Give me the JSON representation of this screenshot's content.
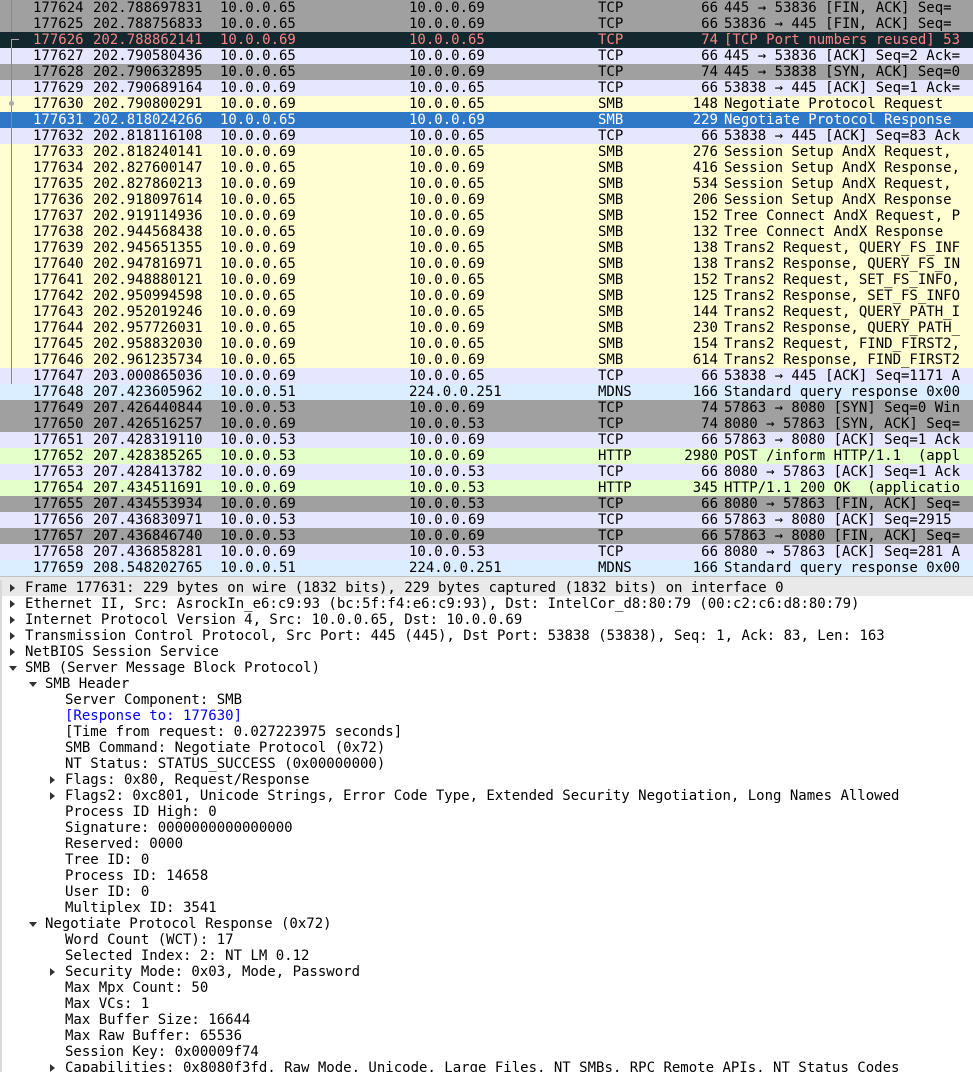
{
  "colors": {
    "tcp_light": "#e7e6ff",
    "tcp_gray": "#a0a0a0",
    "tcp_dark": "#12272e",
    "tcp_dark_text": "#f78787",
    "smb": "#fefed0",
    "selected": "#2f78c8",
    "mdns": "#daeeff",
    "http": "#e4ffc7",
    "details_highlight": "#e9e9e9",
    "link": "#0000ee"
  },
  "packets": [
    {
      "no": "177624",
      "time": "202.788697831",
      "src": "10.0.0.65",
      "dst": "10.0.0.69",
      "proto": "TCP",
      "len": "66",
      "info": "445 → 53836 [FIN, ACK] Seq=",
      "style": "tcp_gray",
      "marker": "line"
    },
    {
      "no": "177625",
      "time": "202.788756833",
      "src": "10.0.0.65",
      "dst": "10.0.0.69",
      "proto": "TCP",
      "len": "66",
      "info": "53836 → 445 [FIN, ACK] Seq=",
      "style": "tcp_gray",
      "marker": "line"
    },
    {
      "no": "177626",
      "time": "202.788862141",
      "src": "10.0.0.69",
      "dst": "10.0.0.65",
      "proto": "TCP",
      "len": "74",
      "info": "[TCP Port numbers reused] 53",
      "style": "tcp_dark",
      "marker": "corner"
    },
    {
      "no": "177627",
      "time": "202.790580436",
      "src": "10.0.0.65",
      "dst": "10.0.0.69",
      "proto": "TCP",
      "len": "66",
      "info": "445 → 53836 [ACK] Seq=2 Ack=",
      "style": "tcp_light",
      "marker": "line"
    },
    {
      "no": "177628",
      "time": "202.790632895",
      "src": "10.0.0.65",
      "dst": "10.0.0.69",
      "proto": "TCP",
      "len": "74",
      "info": "445 → 53838 [SYN, ACK] Seq=0",
      "style": "tcp_gray",
      "marker": "line"
    },
    {
      "no": "177629",
      "time": "202.790689164",
      "src": "10.0.0.69",
      "dst": "10.0.0.65",
      "proto": "TCP",
      "len": "66",
      "info": "53838 → 445 [ACK] Seq=1 Ack=",
      "style": "tcp_light",
      "marker": "line"
    },
    {
      "no": "177630",
      "time": "202.790800291",
      "src": "10.0.0.69",
      "dst": "10.0.0.65",
      "proto": "SMB",
      "len": "148",
      "info": "Negotiate Protocol Request",
      "style": "smb",
      "marker": "dot"
    },
    {
      "no": "177631",
      "time": "202.818024266",
      "src": "10.0.0.65",
      "dst": "10.0.0.69",
      "proto": "SMB",
      "len": "229",
      "info": "Negotiate Protocol Response",
      "style": "selected",
      "marker": "line"
    },
    {
      "no": "177632",
      "time": "202.818116108",
      "src": "10.0.0.69",
      "dst": "10.0.0.65",
      "proto": "TCP",
      "len": "66",
      "info": "53838 → 445 [ACK] Seq=83 Ack",
      "style": "tcp_light",
      "marker": "line"
    },
    {
      "no": "177633",
      "time": "202.818240141",
      "src": "10.0.0.69",
      "dst": "10.0.0.65",
      "proto": "SMB",
      "len": "276",
      "info": "Session Setup AndX Request, ",
      "style": "smb",
      "marker": "line"
    },
    {
      "no": "177634",
      "time": "202.827600147",
      "src": "10.0.0.65",
      "dst": "10.0.0.69",
      "proto": "SMB",
      "len": "416",
      "info": "Session Setup AndX Response,",
      "style": "smb",
      "marker": "line"
    },
    {
      "no": "177635",
      "time": "202.827860213",
      "src": "10.0.0.69",
      "dst": "10.0.0.65",
      "proto": "SMB",
      "len": "534",
      "info": "Session Setup AndX Request, ",
      "style": "smb",
      "marker": "line"
    },
    {
      "no": "177636",
      "time": "202.918097614",
      "src": "10.0.0.65",
      "dst": "10.0.0.69",
      "proto": "SMB",
      "len": "206",
      "info": "Session Setup AndX Response",
      "style": "smb",
      "marker": "line"
    },
    {
      "no": "177637",
      "time": "202.919114936",
      "src": "10.0.0.69",
      "dst": "10.0.0.65",
      "proto": "SMB",
      "len": "152",
      "info": "Tree Connect AndX Request, P",
      "style": "smb",
      "marker": "line"
    },
    {
      "no": "177638",
      "time": "202.944568438",
      "src": "10.0.0.65",
      "dst": "10.0.0.69",
      "proto": "SMB",
      "len": "132",
      "info": "Tree Connect AndX Response",
      "style": "smb",
      "marker": "line"
    },
    {
      "no": "177639",
      "time": "202.945651355",
      "src": "10.0.0.69",
      "dst": "10.0.0.65",
      "proto": "SMB",
      "len": "138",
      "info": "Trans2 Request, QUERY_FS_INF",
      "style": "smb",
      "marker": "line"
    },
    {
      "no": "177640",
      "time": "202.947816971",
      "src": "10.0.0.65",
      "dst": "10.0.0.69",
      "proto": "SMB",
      "len": "138",
      "info": "Trans2 Response, QUERY_FS_IN",
      "style": "smb",
      "marker": "line"
    },
    {
      "no": "177641",
      "time": "202.948880121",
      "src": "10.0.0.69",
      "dst": "10.0.0.65",
      "proto": "SMB",
      "len": "152",
      "info": "Trans2 Request, SET_FS_INFO,",
      "style": "smb",
      "marker": "line"
    },
    {
      "no": "177642",
      "time": "202.950994598",
      "src": "10.0.0.65",
      "dst": "10.0.0.69",
      "proto": "SMB",
      "len": "125",
      "info": "Trans2 Response, SET_FS_INFO",
      "style": "smb",
      "marker": "line"
    },
    {
      "no": "177643",
      "time": "202.952019246",
      "src": "10.0.0.69",
      "dst": "10.0.0.65",
      "proto": "SMB",
      "len": "144",
      "info": "Trans2 Request, QUERY_PATH_I",
      "style": "smb",
      "marker": "line"
    },
    {
      "no": "177644",
      "time": "202.957726031",
      "src": "10.0.0.65",
      "dst": "10.0.0.69",
      "proto": "SMB",
      "len": "230",
      "info": "Trans2 Response, QUERY_PATH_",
      "style": "smb",
      "marker": "line"
    },
    {
      "no": "177645",
      "time": "202.958832030",
      "src": "10.0.0.69",
      "dst": "10.0.0.65",
      "proto": "SMB",
      "len": "154",
      "info": "Trans2 Request, FIND_FIRST2,",
      "style": "smb",
      "marker": "line"
    },
    {
      "no": "177646",
      "time": "202.961235734",
      "src": "10.0.0.65",
      "dst": "10.0.0.69",
      "proto": "SMB",
      "len": "614",
      "info": "Trans2 Response, FIND_FIRST2",
      "style": "smb",
      "marker": "line"
    },
    {
      "no": "177647",
      "time": "203.000865036",
      "src": "10.0.0.69",
      "dst": "10.0.0.65",
      "proto": "TCP",
      "len": "66",
      "info": "53838 → 445 [ACK] Seq=1171 A",
      "style": "tcp_light",
      "marker": "line"
    },
    {
      "no": "177648",
      "time": "207.423605962",
      "src": "10.0.0.51",
      "dst": "224.0.0.251",
      "proto": "MDNS",
      "len": "166",
      "info": "Standard query response 0x00",
      "style": "mdns",
      "marker": "none"
    },
    {
      "no": "177649",
      "time": "207.426440844",
      "src": "10.0.0.53",
      "dst": "10.0.0.69",
      "proto": "TCP",
      "len": "74",
      "info": "57863 → 8080 [SYN] Seq=0 Win",
      "style": "tcp_gray",
      "marker": "none"
    },
    {
      "no": "177650",
      "time": "207.426516257",
      "src": "10.0.0.69",
      "dst": "10.0.0.53",
      "proto": "TCP",
      "len": "74",
      "info": "8080 → 57863 [SYN, ACK] Seq=",
      "style": "tcp_gray",
      "marker": "none"
    },
    {
      "no": "177651",
      "time": "207.428319110",
      "src": "10.0.0.53",
      "dst": "10.0.0.69",
      "proto": "TCP",
      "len": "66",
      "info": "57863 → 8080 [ACK] Seq=1 Ack",
      "style": "tcp_light",
      "marker": "none"
    },
    {
      "no": "177652",
      "time": "207.428385265",
      "src": "10.0.0.53",
      "dst": "10.0.0.69",
      "proto": "HTTP",
      "len": "2980",
      "info": "POST /inform HTTP/1.1  (appl",
      "style": "http",
      "marker": "none"
    },
    {
      "no": "177653",
      "time": "207.428413782",
      "src": "10.0.0.69",
      "dst": "10.0.0.53",
      "proto": "TCP",
      "len": "66",
      "info": "8080 → 57863 [ACK] Seq=1 Ack",
      "style": "tcp_light",
      "marker": "none"
    },
    {
      "no": "177654",
      "time": "207.434511691",
      "src": "10.0.0.69",
      "dst": "10.0.0.53",
      "proto": "HTTP",
      "len": "345",
      "info": "HTTP/1.1 200 OK  (applicatio",
      "style": "http",
      "marker": "none"
    },
    {
      "no": "177655",
      "time": "207.434553934",
      "src": "10.0.0.69",
      "dst": "10.0.0.53",
      "proto": "TCP",
      "len": "66",
      "info": "8080 → 57863 [FIN, ACK] Seq=",
      "style": "tcp_gray",
      "marker": "none"
    },
    {
      "no": "177656",
      "time": "207.436830971",
      "src": "10.0.0.53",
      "dst": "10.0.0.69",
      "proto": "TCP",
      "len": "66",
      "info": "57863 → 8080 [ACK] Seq=2915 ",
      "style": "tcp_light",
      "marker": "none"
    },
    {
      "no": "177657",
      "time": "207.436846740",
      "src": "10.0.0.53",
      "dst": "10.0.0.69",
      "proto": "TCP",
      "len": "66",
      "info": "57863 → 8080 [FIN, ACK] Seq=",
      "style": "tcp_gray",
      "marker": "none"
    },
    {
      "no": "177658",
      "time": "207.436858281",
      "src": "10.0.0.69",
      "dst": "10.0.0.53",
      "proto": "TCP",
      "len": "66",
      "info": "8080 → 57863 [ACK] Seq=281 A",
      "style": "tcp_light",
      "marker": "none"
    },
    {
      "no": "177659",
      "time": "208.548202765",
      "src": "10.0.0.51",
      "dst": "224.0.0.251",
      "proto": "MDNS",
      "len": "166",
      "info": "Standard query response 0x00",
      "style": "mdns",
      "marker": "none"
    }
  ],
  "details": [
    {
      "level": 0,
      "toggle": "collapsed",
      "text": "Frame 177631: 229 bytes on wire (1832 bits), 229 bytes captured (1832 bits) on interface 0",
      "highlight": true
    },
    {
      "level": 0,
      "toggle": "collapsed",
      "text": "Ethernet II, Src: AsrockIn_e6:c9:93 (bc:5f:f4:e6:c9:93), Dst: IntelCor_d8:80:79 (00:c2:c6:d8:80:79)"
    },
    {
      "level": 0,
      "toggle": "collapsed",
      "text": "Internet Protocol Version 4, Src: 10.0.0.65, Dst: 10.0.0.69"
    },
    {
      "level": 0,
      "toggle": "collapsed",
      "text": "Transmission Control Protocol, Src Port: 445 (445), Dst Port: 53838 (53838), Seq: 1, Ack: 83, Len: 163"
    },
    {
      "level": 0,
      "toggle": "collapsed",
      "text": "NetBIOS Session Service"
    },
    {
      "level": 0,
      "toggle": "expanded",
      "text": "SMB (Server Message Block Protocol)"
    },
    {
      "level": 1,
      "toggle": "expanded",
      "text": "SMB Header"
    },
    {
      "level": 2,
      "toggle": "none",
      "text": "Server Component: SMB"
    },
    {
      "level": 2,
      "toggle": "none",
      "text": "[Response to: 177630]",
      "link": true
    },
    {
      "level": 2,
      "toggle": "none",
      "text": "[Time from request: 0.027223975 seconds]"
    },
    {
      "level": 2,
      "toggle": "none",
      "text": "SMB Command: Negotiate Protocol (0x72)"
    },
    {
      "level": 2,
      "toggle": "none",
      "text": "NT Status: STATUS_SUCCESS (0x00000000)"
    },
    {
      "level": 2,
      "toggle": "collapsed",
      "text": "Flags: 0x80, Request/Response"
    },
    {
      "level": 2,
      "toggle": "collapsed",
      "text": "Flags2: 0xc801, Unicode Strings, Error Code Type, Extended Security Negotiation, Long Names Allowed"
    },
    {
      "level": 2,
      "toggle": "none",
      "text": "Process ID High: 0"
    },
    {
      "level": 2,
      "toggle": "none",
      "text": "Signature: 0000000000000000"
    },
    {
      "level": 2,
      "toggle": "none",
      "text": "Reserved: 0000"
    },
    {
      "level": 2,
      "toggle": "none",
      "text": "Tree ID: 0"
    },
    {
      "level": 2,
      "toggle": "none",
      "text": "Process ID: 14658"
    },
    {
      "level": 2,
      "toggle": "none",
      "text": "User ID: 0"
    },
    {
      "level": 2,
      "toggle": "none",
      "text": "Multiplex ID: 3541"
    },
    {
      "level": 1,
      "toggle": "expanded",
      "text": "Negotiate Protocol Response (0x72)"
    },
    {
      "level": 2,
      "toggle": "none",
      "text": "Word Count (WCT): 17"
    },
    {
      "level": 2,
      "toggle": "none",
      "text": "Selected Index: 2: NT LM 0.12"
    },
    {
      "level": 2,
      "toggle": "collapsed",
      "text": "Security Mode: 0x03, Mode, Password"
    },
    {
      "level": 2,
      "toggle": "none",
      "text": "Max Mpx Count: 50"
    },
    {
      "level": 2,
      "toggle": "none",
      "text": "Max VCs: 1"
    },
    {
      "level": 2,
      "toggle": "none",
      "text": "Max Buffer Size: 16644"
    },
    {
      "level": 2,
      "toggle": "none",
      "text": "Max Raw Buffer: 65536"
    },
    {
      "level": 2,
      "toggle": "none",
      "text": "Session Key: 0x00009f74"
    },
    {
      "level": 2,
      "toggle": "collapsed",
      "text": "Capabilities: 0x8080f3fd, Raw Mode, Unicode, Large Files, NT SMBs, RPC Remote APIs, NT Status Codes"
    }
  ]
}
